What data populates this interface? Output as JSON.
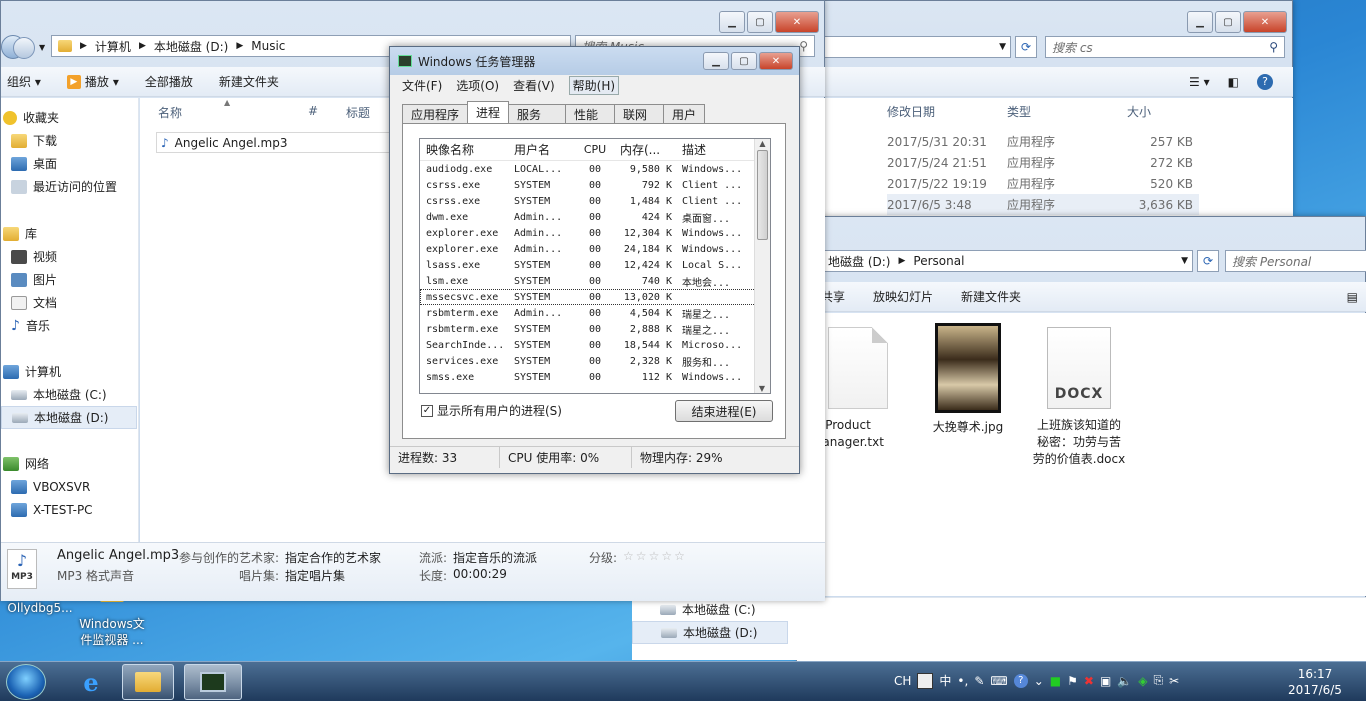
{
  "explorer_music": {
    "breadcrumb": [
      "计算机",
      "本地磁盘 (D:)",
      "Music"
    ],
    "search_placeholder": "搜索 Music",
    "toolbar": {
      "organize": "组织",
      "play": "播放",
      "play_all": "全部播放",
      "new_folder": "新建文件夹"
    },
    "columns": {
      "name": "名称",
      "num": "#",
      "title": "标题"
    },
    "files": [
      "Angelic Angel.mp3"
    ],
    "nav": {
      "favorites": "收藏夹",
      "downloads": "下载",
      "desktop": "桌面",
      "recent": "最近访问的位置",
      "libraries": "库",
      "videos": "视频",
      "pictures": "图片",
      "documents": "文档",
      "music": "音乐",
      "computer": "计算机",
      "drive_c": "本地磁盘 (C:)",
      "drive_d": "本地磁盘 (D:)",
      "network": "网络",
      "vboxsvr": "VBOXSVR",
      "xtestpc": "X-TEST-PC"
    },
    "details": {
      "filename": "Angelic Angel.mp3",
      "filetype": "MP3 格式声音",
      "artist_label": "参与创作的艺术家:",
      "artist_value": "指定合作的艺术家",
      "album_label": "唱片集:",
      "album_value": "指定唱片集",
      "genre_label": "流派:",
      "genre_value": "指定音乐的流派",
      "length_label": "长度:",
      "length_value": "00:00:29",
      "rating_label": "分级:",
      "mp3_badge": "MP3"
    }
  },
  "explorer_cs": {
    "search_placeholder": "搜索 cs",
    "columns": {
      "modified": "修改日期",
      "type": "类型",
      "size": "大小"
    },
    "rows": [
      {
        "date": "2017/5/31 20:31",
        "type": "应用程序",
        "size": "257 KB"
      },
      {
        "date": "2017/5/24 21:51",
        "type": "应用程序",
        "size": "272 KB"
      },
      {
        "date": "2017/5/22 19:19",
        "type": "应用程序",
        "size": "520 KB"
      },
      {
        "date": "2017/6/5 3:48",
        "type": "应用程序",
        "size": "3,636 KB"
      }
    ]
  },
  "explorer_personal": {
    "breadcrumb": [
      "地磁盘 (D:)",
      "Personal"
    ],
    "search_placeholder": "搜索 Personal",
    "toolbar": {
      "share": "共享",
      "slideshow": "放映幻灯片",
      "new_folder": "新建文件夹"
    },
    "files": [
      {
        "name": "Product\nManager.txt"
      },
      {
        "name": "大挽尊术.jpg"
      },
      {
        "name": "上班族该知道的\n秘密：功劳与苦\n劳的价值表.docx",
        "badge": "DOCX"
      }
    ],
    "nav": {
      "drive_c": "本地磁盘 (C:)",
      "drive_d": "本地磁盘 (D:)"
    }
  },
  "taskmgr": {
    "title": "Windows 任务管理器",
    "menu": [
      "文件(F)",
      "选项(O)",
      "查看(V)",
      "帮助(H)"
    ],
    "tabs": [
      "应用程序",
      "进程",
      "服务",
      "性能",
      "联网",
      "用户"
    ],
    "columns": [
      "映像名称",
      "用户名",
      "CPU",
      "内存(...",
      "描述"
    ],
    "processes": [
      [
        "audiodg.exe",
        "LOCAL...",
        "00",
        "9,580 K",
        "Windows..."
      ],
      [
        "csrss.exe",
        "SYSTEM",
        "00",
        "792 K",
        "Client ..."
      ],
      [
        "csrss.exe",
        "SYSTEM",
        "00",
        "1,484 K",
        "Client ..."
      ],
      [
        "dwm.exe",
        "Admin...",
        "00",
        "424 K",
        "桌面窗..."
      ],
      [
        "explorer.exe",
        "Admin...",
        "00",
        "12,304 K",
        "Windows..."
      ],
      [
        "explorer.exe",
        "Admin...",
        "00",
        "24,184 K",
        "Windows..."
      ],
      [
        "lsass.exe",
        "SYSTEM",
        "00",
        "12,424 K",
        "Local S..."
      ],
      [
        "lsm.exe",
        "SYSTEM",
        "00",
        "740 K",
        "本地会..."
      ],
      [
        "mssecsvc.exe",
        "SYSTEM",
        "00",
        "13,020 K",
        ""
      ],
      [
        "rsbmterm.exe",
        "Admin...",
        "00",
        "4,504 K",
        "瑞星之..."
      ],
      [
        "rsbmterm.exe",
        "SYSTEM",
        "00",
        "2,888 K",
        "瑞星之..."
      ],
      [
        "SearchInde...",
        "SYSTEM",
        "00",
        "18,544 K",
        "Microso..."
      ],
      [
        "services.exe",
        "SYSTEM",
        "00",
        "2,328 K",
        "服务和..."
      ],
      [
        "smss.exe",
        "SYSTEM",
        "00",
        "112 K",
        "Windows..."
      ]
    ],
    "show_all_label": "显示所有用户的进程(S)",
    "show_all_checked": true,
    "end_process": "结束进程(E)",
    "status": {
      "procs": "进程数: 33",
      "cpu": "CPU 使用率: 0%",
      "mem": "物理内存: 29%"
    }
  },
  "desktop_icons": [
    {
      "label": "Ollydbg5..."
    },
    {
      "label": "Windows文\n件监视器 ..."
    }
  ],
  "tray": {
    "lang": "CH",
    "ime": "中",
    "time": "16:17",
    "date": "2017/6/5"
  }
}
